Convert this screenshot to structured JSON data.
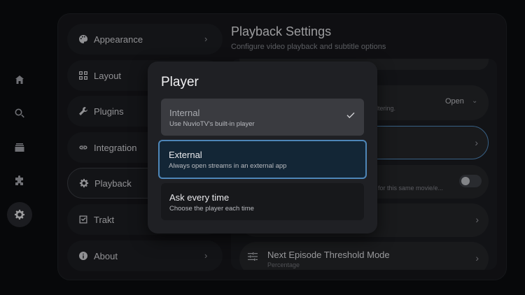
{
  "categories": [
    {
      "label": "Appearance",
      "icon": "palette-icon"
    },
    {
      "label": "Layout",
      "icon": "grid-icon"
    },
    {
      "label": "Plugins",
      "icon": "wrench-icon"
    },
    {
      "label": "Integration",
      "icon": "link-icon"
    },
    {
      "label": "Playback",
      "icon": "gear-icon"
    },
    {
      "label": "Trakt",
      "icon": "checkbox-icon"
    },
    {
      "label": "About",
      "icon": "info-icon"
    }
  ],
  "rail": [
    "home-icon",
    "search-icon",
    "library-icon",
    "puzzle-icon",
    "settings-icon"
  ],
  "content": {
    "title": "Playback Settings",
    "subtitle": "Configure video playback and subtitle options",
    "bg_text_1": "ltering.",
    "open_label": "Open",
    "bg_text_2": "for this same movie/e...",
    "next_title": "Next Episode Threshold Mode",
    "next_sub": "Percentage"
  },
  "dialog": {
    "title": "Player",
    "options": [
      {
        "title": "Internal",
        "desc": "Use NuvioTV's built-in player"
      },
      {
        "title": "External",
        "desc": "Always open streams in an external app"
      },
      {
        "title": "Ask every time",
        "desc": "Choose the player each time"
      }
    ]
  }
}
